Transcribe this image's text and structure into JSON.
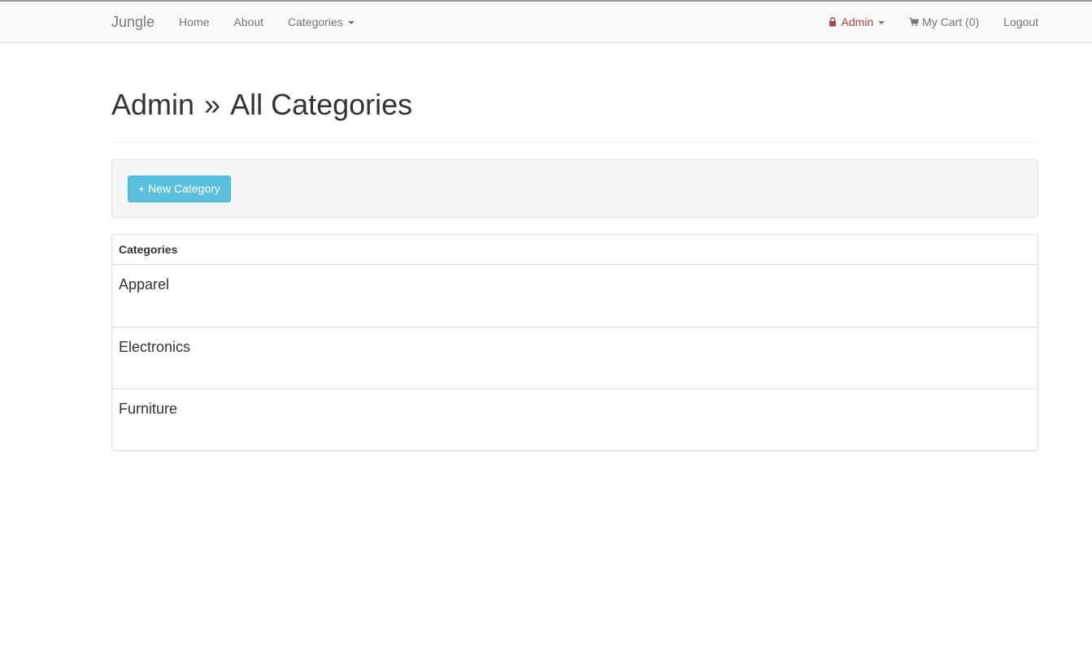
{
  "navbar": {
    "brand": "Jungle",
    "left_links": [
      {
        "label": "Home"
      },
      {
        "label": "About"
      },
      {
        "label": "Categories"
      }
    ],
    "admin_label": "Admin",
    "cart_label": "My Cart (0)",
    "logout_label": "Logout",
    "admin_color": "#a94442"
  },
  "page": {
    "title_part1": "Admin",
    "separator": "»",
    "title_part2": "All Categories"
  },
  "actions": {
    "new_category_label": "+ New Category",
    "button_color": "#5bc0de"
  },
  "categories_table": {
    "header": "Categories",
    "rows": [
      {
        "name": "Apparel"
      },
      {
        "name": "Electronics"
      },
      {
        "name": "Furniture"
      }
    ]
  }
}
